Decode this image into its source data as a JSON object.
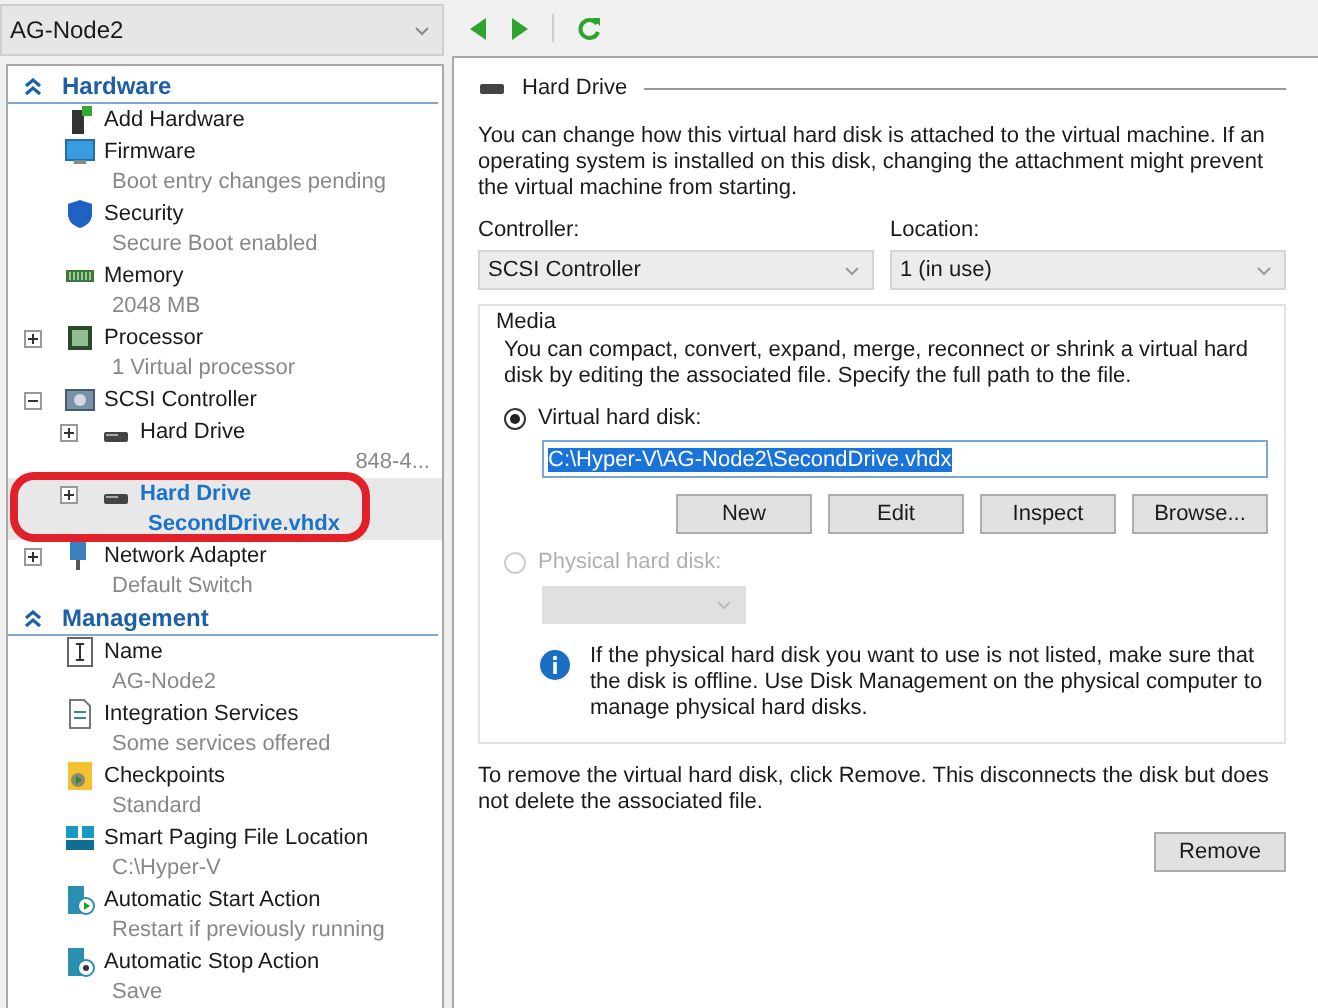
{
  "vm_selector": {
    "value": "AG-Node2"
  },
  "sidebar": {
    "sections": [
      {
        "title": "Hardware",
        "expanded": true,
        "items": [
          {
            "label": "Add Hardware",
            "selected": false
          },
          {
            "label": "Firmware",
            "detail": "Boot entry changes pending",
            "selected": false
          },
          {
            "label": "Security",
            "detail": "Secure Boot enabled",
            "selected": false
          },
          {
            "label": "Memory",
            "detail": "2048 MB",
            "selected": false
          },
          {
            "label": "Processor",
            "detail": "1 Virtual processor",
            "expanded": false,
            "selected": false
          },
          {
            "label": "SCSI Controller",
            "expanded": true,
            "selected": false,
            "children": [
              {
                "label": "Hard Drive",
                "detail": "848-4...",
                "expanded": false,
                "selected": false
              },
              {
                "label": "Hard Drive",
                "detail": "SecondDrive.vhdx",
                "expanded": false,
                "selected": true
              }
            ]
          },
          {
            "label": "Network Adapter",
            "detail": "Default Switch",
            "expanded": false,
            "selected": false
          }
        ]
      },
      {
        "title": "Management",
        "expanded": true,
        "items": [
          {
            "label": "Name",
            "detail": "AG-Node2",
            "selected": false
          },
          {
            "label": "Integration Services",
            "detail": "Some services offered",
            "selected": false
          },
          {
            "label": "Checkpoints",
            "detail": "Standard",
            "selected": false
          },
          {
            "label": "Smart Paging File Location",
            "detail": "C:\\Hyper-V",
            "selected": false
          },
          {
            "label": "Automatic Start Action",
            "detail": "Restart if previously running",
            "selected": false
          },
          {
            "label": "Automatic Stop Action",
            "detail": "Save",
            "selected": false
          }
        ]
      }
    ]
  },
  "panel": {
    "title": "Hard Drive",
    "intro": "You can change how this virtual hard disk is attached to the virtual machine. If an operating system is installed on this disk, changing the attachment might prevent the virtual machine from starting.",
    "controller": {
      "label": "Controller:",
      "value": "SCSI Controller"
    },
    "location": {
      "label": "Location:",
      "value": "1 (in use)"
    },
    "media": {
      "title": "Media",
      "description": "You can compact, convert, expand, merge, reconnect or shrink a virtual hard disk by editing the associated file. Specify the full path to the file.",
      "virtual_disk": {
        "label": "Virtual hard disk:",
        "selected": true,
        "disabled": false
      },
      "path": {
        "value": "C:\\Hyper-V\\AG-Node2\\SecondDrive.vhdx",
        "highlighted": true
      },
      "buttons": [
        "New",
        "Edit",
        "Inspect",
        "Browse..."
      ],
      "physical_disk": {
        "label": "Physical hard disk:",
        "selected": false,
        "disabled": true
      },
      "physical_dropdown": {
        "disabled": true
      },
      "info": "If the physical hard disk you want to use is not listed, make sure that the disk is offline. Use Disk Management on the physical computer to manage physical hard disks."
    },
    "remove_note": "To remove the virtual hard disk, click Remove. This disconnects the disk but does not delete the associated file.",
    "remove_button": "Remove"
  }
}
